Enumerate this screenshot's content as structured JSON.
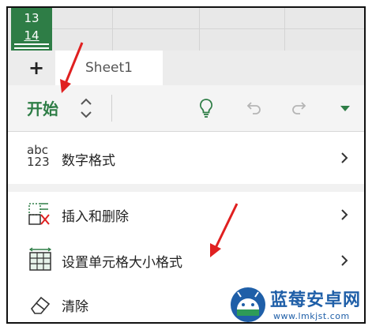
{
  "grid": {
    "row_numbers": [
      "13",
      "14"
    ]
  },
  "tabbar": {
    "add_sheet_label": "+",
    "sheet_tab_label": "Sheet1"
  },
  "ribbon": {
    "tab_label": "开始"
  },
  "menu": {
    "items": [
      {
        "label": "数字格式",
        "icon": "number-format-icon"
      },
      {
        "label": "插入和删除",
        "icon": "insert-delete-icon"
      },
      {
        "label": "设置单元格大小格式",
        "icon": "cell-size-format-icon"
      },
      {
        "label": "清除",
        "icon": "eraser-icon"
      }
    ],
    "number_format_icon_text": {
      "top": "abc",
      "bottom": "123"
    }
  },
  "watermark": {
    "brand": "蓝莓安卓网",
    "url": "www.lmkjst.com"
  },
  "colors": {
    "accent": "#2e7d46",
    "annotation": "#e02020",
    "brand": "#1f5fa8"
  }
}
